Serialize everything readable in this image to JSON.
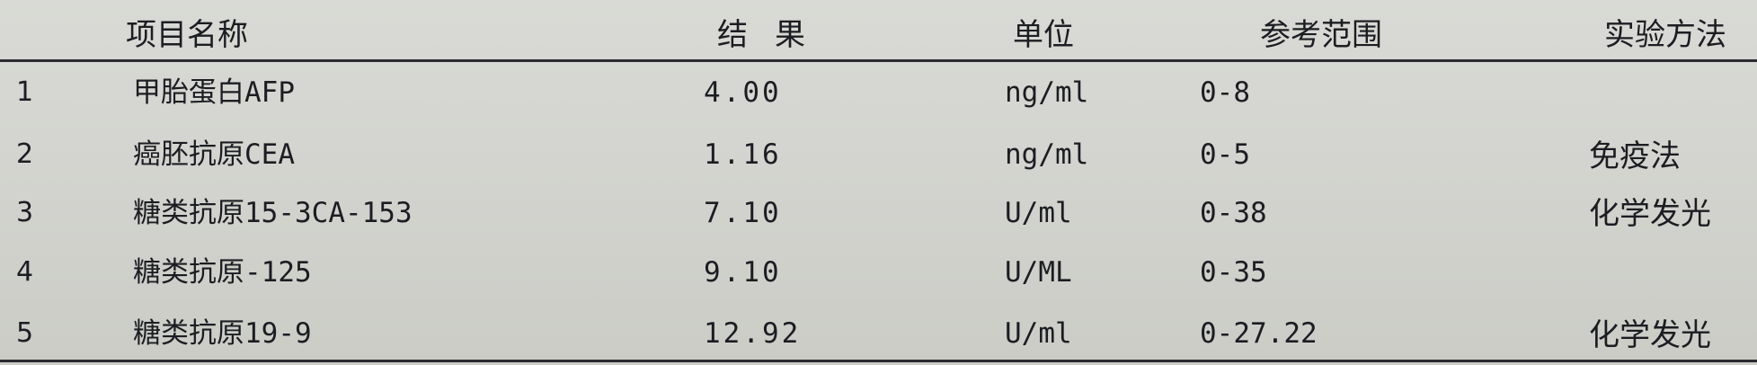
{
  "headers": {
    "name": "项目名称",
    "result": "结果",
    "unit": "单位",
    "range": "参考范围",
    "method": "实验方法"
  },
  "rows": [
    {
      "no": "1",
      "name": "甲胎蛋白AFP",
      "result": "4.00",
      "unit": "ng/ml",
      "range": "0-8",
      "method": ""
    },
    {
      "no": "2",
      "name": "癌胚抗原CEA",
      "result": "1.16",
      "unit": "ng/ml",
      "range": "0-5",
      "method": "免疫法"
    },
    {
      "no": "3",
      "name": "糖类抗原15-3CA-153",
      "result": "7.10",
      "unit": "U/ml",
      "range": "0-38",
      "method": "化学发光"
    },
    {
      "no": "4",
      "name": "糖类抗原-125",
      "result": "9.10",
      "unit": "U/ML",
      "range": "0-35",
      "method": ""
    },
    {
      "no": "5",
      "name": "糖类抗原19-9",
      "result": "12.92",
      "unit": "U/ml",
      "range": "0-27.22",
      "method": "化学发光"
    }
  ]
}
